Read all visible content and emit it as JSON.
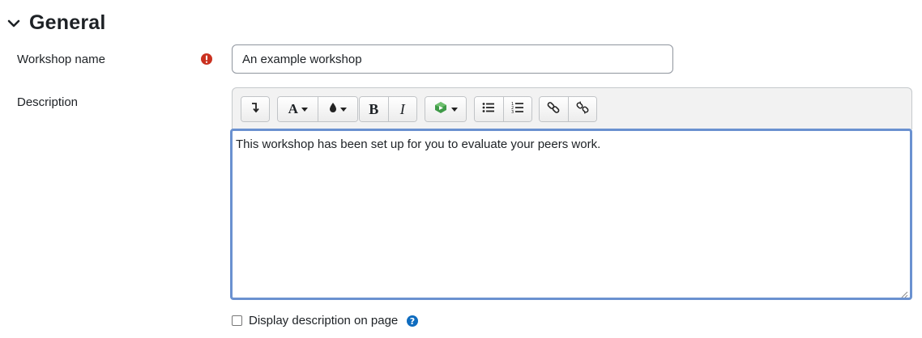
{
  "section": {
    "title": "General"
  },
  "fields": {
    "workshop_name": {
      "label": "Workshop name",
      "value": "An example workshop"
    },
    "description": {
      "label": "Description",
      "content": "This workshop has been set up for you to evaluate your peers work."
    }
  },
  "toolbar": {
    "groups": [
      {
        "items": [
          "collapse-toolbar-icon"
        ]
      },
      {
        "items": [
          "font-style-icon",
          "text-color-icon"
        ]
      },
      {
        "items": [
          "bold-icon",
          "italic-icon"
        ]
      },
      {
        "items": [
          "media-icon"
        ]
      },
      {
        "items": [
          "unordered-list-icon",
          "ordered-list-icon"
        ]
      },
      {
        "items": [
          "link-icon",
          "unlink-icon"
        ]
      }
    ],
    "bold_glyph": "B",
    "italic_glyph": "I",
    "font_glyph": "A"
  },
  "checkbox": {
    "label": "Display description on page",
    "checked": false
  },
  "colors": {
    "required": "#ca3120",
    "help": "#0f6cbf",
    "focus_border": "#6a91d0",
    "chevron": "#1d2125"
  }
}
